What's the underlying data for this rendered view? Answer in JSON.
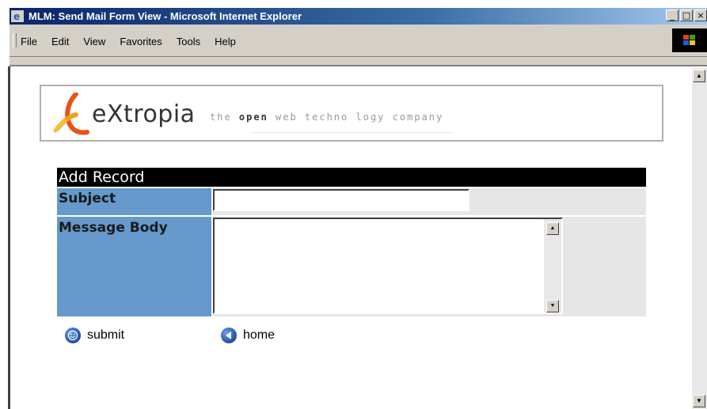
{
  "window": {
    "title": "MLM: Send Mail Form View - Microsoft Internet Explorer",
    "buttons": {
      "minimize": "_",
      "maximize": "□",
      "close": "×"
    }
  },
  "menu": {
    "items": [
      {
        "label": "File"
      },
      {
        "label": "Edit"
      },
      {
        "label": "View"
      },
      {
        "label": "Favorites"
      },
      {
        "label": "Tools"
      },
      {
        "label": "Help"
      }
    ]
  },
  "header": {
    "brand": "eXtropia",
    "tagline_pre": "the ",
    "tagline_bold": "open",
    "tagline_post": " web techno logy company"
  },
  "form": {
    "title": "Add Record",
    "subject_label": "Subject",
    "subject_value": "",
    "body_label": "Message Body",
    "body_value": ""
  },
  "actions": {
    "submit": "submit",
    "home": "home"
  },
  "colors": {
    "label_bg": "#6699cc",
    "header_bg": "#000000",
    "field_bg": "#e6e6e6"
  }
}
